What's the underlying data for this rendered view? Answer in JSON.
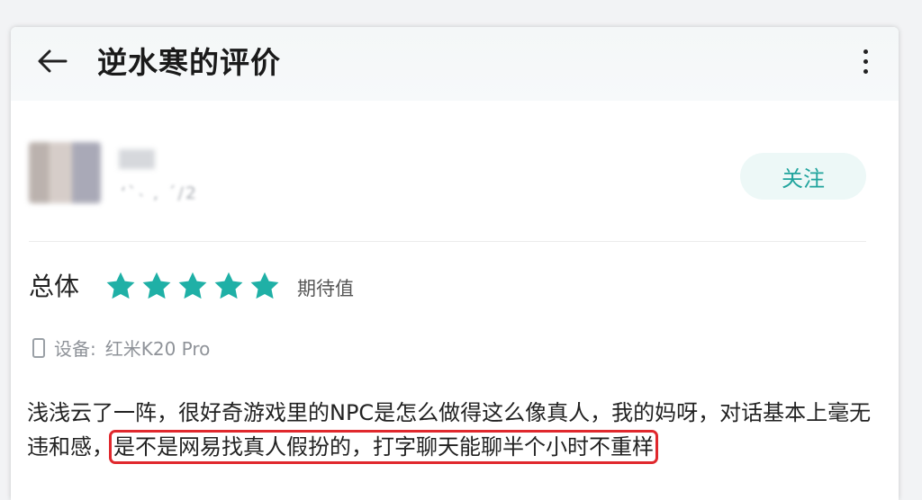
{
  "header": {
    "title": "逆水寒的评价",
    "back_icon": "arrow-left-icon",
    "more_icon": "vertical-dots-icon"
  },
  "user": {
    "meta_partial": "‘ˋ˴ ,  ˊ/2",
    "follow_label": "关注"
  },
  "rating": {
    "overall_label": "总体",
    "stars": 5,
    "max_stars": 5,
    "star_color": "#1fb0a6",
    "expect_label": "期待值"
  },
  "device": {
    "label": "设备:",
    "model": "红米K20 Pro"
  },
  "review": {
    "text_plain": "浅浅云了一阵，很好奇游戏里的NPC是怎么做得这么像真人，我的妈呀，对话基本上毫无违和感，",
    "text_highlight": "是不是网易找真人假扮的，打字聊天能聊半个小时不重样",
    "highlight_color": "#e0282d"
  }
}
